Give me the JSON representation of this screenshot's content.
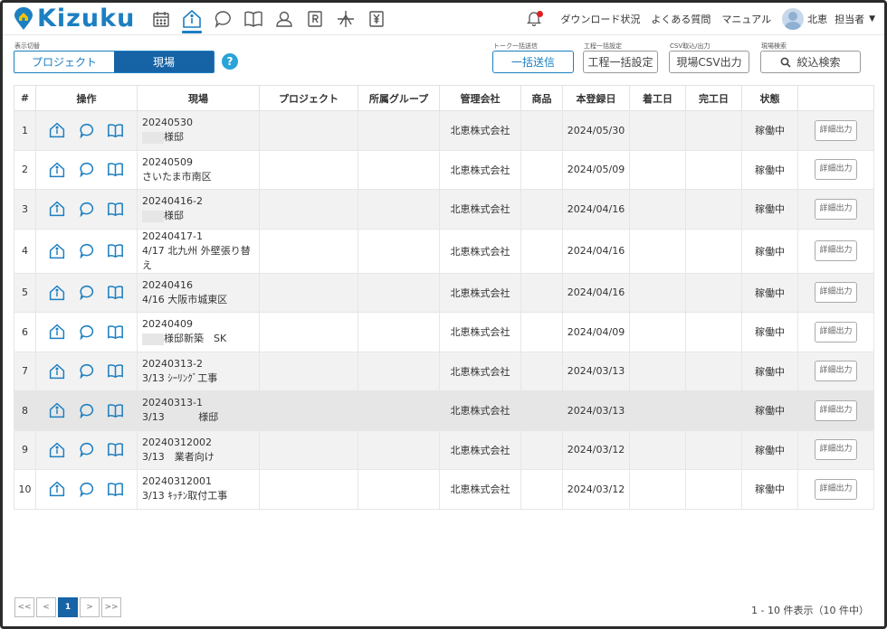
{
  "app": {
    "name": "Kizuku"
  },
  "header": {
    "links": [
      "ダウンロード状況",
      "よくある質問",
      "マニュアル"
    ],
    "user_name": "北恵",
    "user_role": "担当者"
  },
  "toolbar": {
    "view_switch_caption": "表示切替",
    "view_options": [
      "プロジェクト",
      "現場"
    ],
    "help_label": "?",
    "bulk_send_caption": "トーク一括送信",
    "bulk_send_label": "一括送信",
    "process_caption": "工程一括設定",
    "process_label": "工程一括設定",
    "csv_caption": "CSV取込/出力",
    "csv_label": "現場CSV出力",
    "search_caption": "現場検索",
    "search_label": "絞込検索"
  },
  "table": {
    "columns": [
      "#",
      "操作",
      "現場",
      "プロジェクト",
      "所属グループ",
      "管理会社",
      "商品",
      "本登録日",
      "着工日",
      "完工日",
      "状態",
      ""
    ],
    "rows": [
      {
        "no": "1",
        "code": "20240530",
        "name": "様邸",
        "project": "",
        "group": "",
        "company": "北恵株式会社",
        "product": "",
        "registered": "2024/05/30",
        "start": "",
        "end": "",
        "status": "稼働中",
        "action": "詳細出力"
      },
      {
        "no": "2",
        "code": "20240509",
        "name": "さいたま市南区",
        "project": "",
        "group": "",
        "company": "北恵株式会社",
        "product": "",
        "registered": "2024/05/09",
        "start": "",
        "end": "",
        "status": "稼働中",
        "action": "詳細出力"
      },
      {
        "no": "3",
        "code": "20240416-2",
        "name": "様邸",
        "project": "",
        "group": "",
        "company": "北恵株式会社",
        "product": "",
        "registered": "2024/04/16",
        "start": "",
        "end": "",
        "status": "稼働中",
        "action": "詳細出力"
      },
      {
        "no": "4",
        "code": "20240417-1",
        "name": "4/17 北九州 外壁張り替え",
        "project": "",
        "group": "",
        "company": "北恵株式会社",
        "product": "",
        "registered": "2024/04/16",
        "start": "",
        "end": "",
        "status": "稼働中",
        "action": "詳細出力"
      },
      {
        "no": "5",
        "code": "20240416",
        "name": "4/16 大阪市城東区",
        "project": "",
        "group": "",
        "company": "北恵株式会社",
        "product": "",
        "registered": "2024/04/16",
        "start": "",
        "end": "",
        "status": "稼働中",
        "action": "詳細出力"
      },
      {
        "no": "6",
        "code": "20240409",
        "name": "様邸新築　SK",
        "project": "",
        "group": "",
        "company": "北恵株式会社",
        "product": "",
        "registered": "2024/04/09",
        "start": "",
        "end": "",
        "status": "稼働中",
        "action": "詳細出力"
      },
      {
        "no": "7",
        "code": "20240313-2",
        "name": "3/13 ｼｰﾘﾝｸﾞ工事",
        "project": "",
        "group": "",
        "company": "北恵株式会社",
        "product": "",
        "registered": "2024/03/13",
        "start": "",
        "end": "",
        "status": "稼働中",
        "action": "詳細出力"
      },
      {
        "no": "8",
        "code": "20240313-1",
        "name": "様邸",
        "name_prefix": "3/13",
        "project": "",
        "group": "",
        "company": "北恵株式会社",
        "product": "",
        "registered": "2024/03/13",
        "start": "",
        "end": "",
        "status": "稼働中",
        "action": "詳細出力"
      },
      {
        "no": "9",
        "code": "20240312002",
        "name": "3/13　業者向け",
        "project": "",
        "group": "",
        "company": "北恵株式会社",
        "product": "",
        "registered": "2024/03/12",
        "start": "",
        "end": "",
        "status": "稼働中",
        "action": "詳細出力"
      },
      {
        "no": "10",
        "code": "20240312001",
        "name": "3/13 ｷｯﾁﾝ取付工事",
        "project": "",
        "group": "",
        "company": "北恵株式会社",
        "product": "",
        "registered": "2024/03/12",
        "start": "",
        "end": "",
        "status": "稼働中",
        "action": "詳細出力"
      }
    ]
  },
  "pagination": {
    "first": "<<",
    "prev": "<",
    "current": "1",
    "next": ">",
    "last": ">>",
    "summary": "1 - 10 件表示（10 件中）"
  },
  "colors": {
    "brand": "#1c7fc1",
    "active_segment": "#1663a6",
    "alert_dot": "#e02020"
  }
}
